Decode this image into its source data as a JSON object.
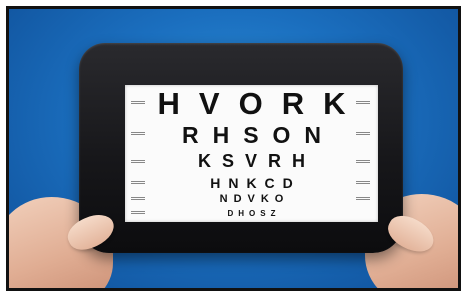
{
  "scene": {
    "description_icon": "eye-chart-photo",
    "background_color": "#1b6fbf",
    "frame_color": "#17171a",
    "card_color": "#fbfbfb"
  },
  "eye_chart": {
    "rows": [
      "HVORK",
      "RHSON",
      "KSVRH",
      "HNKCD",
      "NDVKO",
      "DHOSZ"
    ]
  }
}
